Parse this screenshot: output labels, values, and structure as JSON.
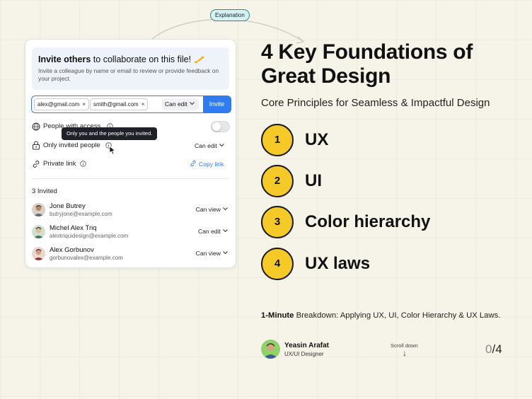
{
  "annotation": {
    "label": "Explanation"
  },
  "dialog": {
    "title_bold": "Invite others",
    "title_rest": " to collaborate on this file!",
    "description": "Invite a colleague by name or email to review or provide feedback on your project.",
    "chips": [
      "alex@gmail.com",
      "smith@gmail.com"
    ],
    "chip_remove": "×",
    "role_select": "Can edit",
    "invite_button": "Invite",
    "access": {
      "people_with_access": "People with access",
      "only_invited": "Only invited people",
      "only_invited_role": "Can edit",
      "private_link": "Private link",
      "copy_link": "Copy link",
      "tooltip": "Only you and the people you invited."
    },
    "invited_count": "3 Invited",
    "people": [
      {
        "name": "Jone Butrey",
        "email": "butryjone@example.com",
        "role": "Can view"
      },
      {
        "name": "Michel Alex Triq",
        "email": "alextriquidesign@example.com",
        "role": "Can edit"
      },
      {
        "name": "Alex Gorbunov",
        "email": "gorbunovalex@example.com",
        "role": "Can view"
      }
    ]
  },
  "content": {
    "heading_line1": "4 Key Foundations of",
    "heading_line2": "Great Design",
    "subheading": "Core Principles for Seamless & Impactful Design",
    "items": [
      {
        "number": "1",
        "label": "UX"
      },
      {
        "number": "2",
        "label": "UI"
      },
      {
        "number": "3",
        "label": "Color hierarchy"
      },
      {
        "number": "4",
        "label": "UX laws"
      }
    ],
    "breakdown_bold": "1-Minute",
    "breakdown_rest": " Breakdown: Applying UX, UI, Color Hierarchy & UX Laws.",
    "author": {
      "name": "Yeasin Arafat",
      "role": "UX/UI Designer"
    },
    "scroll_label": "Scroll down",
    "scroll_arrow": "↓",
    "page_current": "0",
    "page_total": "/4"
  },
  "colors": {
    "background": "#f6f4e8",
    "accent_blue": "#2f7bf0",
    "number_yellow": "#f5c928",
    "tooltip_dark": "#1e2127",
    "pill_teal": "#d6f1ef"
  },
  "icons": [
    "pencil-icon",
    "close-icon",
    "chevron-down-icon",
    "globe-icon",
    "info-icon",
    "lock-icon",
    "link-icon",
    "cursor-icon",
    "avatar",
    "down-arrow-icon"
  ]
}
